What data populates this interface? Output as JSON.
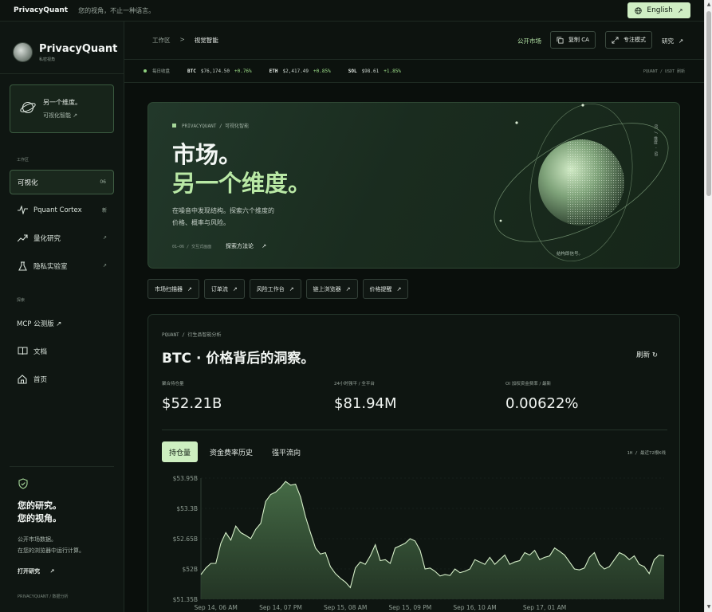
{
  "topbar": {
    "brand": "PrivacyQuant",
    "tagline": "您的视角，不止一种语言。",
    "language": "English"
  },
  "sidebar": {
    "title": "PrivacyQuant",
    "subtitle": "私密视角",
    "feature": {
      "title": "另一个维度。",
      "link": "可视化智能 ↗"
    },
    "workspace_label": "工作区",
    "items": [
      {
        "label": "可视化",
        "badge": "06",
        "icon": "layers-icon"
      },
      {
        "label": "Pquant Cortex",
        "badge": "新",
        "icon": "pulse-icon"
      },
      {
        "label": "量化研究",
        "badge": "↗",
        "icon": "trend-icon"
      },
      {
        "label": "隐私实验室",
        "badge": "↗",
        "icon": "flask-icon"
      }
    ],
    "explore_label": "探索",
    "explore_items": [
      {
        "label": "MCP 公测版 ↗"
      },
      {
        "label": "文档",
        "icon": "book-icon"
      },
      {
        "label": "首页",
        "icon": "home-icon"
      }
    ],
    "quote_l1": "您的研究。",
    "quote_l2": "您的视角。",
    "desc_l1": "公开市场数据。",
    "desc_l2": "在您的浏览器中运行计算。",
    "cta": "打开研究",
    "footer": "PRIVACYQUANT / 数据分析"
  },
  "header": {
    "crumb_root": "工作区",
    "crumb_sep": ">",
    "crumb_current": "视觉智能",
    "public_market": "公开市场",
    "copy_ca": "复制 CA",
    "focus_mode": "专注模式",
    "research": "研究"
  },
  "ticker": {
    "label": "每日收盘",
    "items": [
      {
        "sym": "BTC",
        "price": "$76,174.50",
        "chg": "+0.76%"
      },
      {
        "sym": "ETH",
        "price": "$2,417.49",
        "chg": "+0.85%"
      },
      {
        "sym": "SOL",
        "price": "$98.61",
        "chg": "+1.85%"
      }
    ],
    "right": "PQUANT / USDT 刷新"
  },
  "hero": {
    "tag": "PRIVACYQUANT / 可视化智能",
    "h1_l1": "市场。",
    "h1_l2": "另一个维度。",
    "p_l1": "在噪音中发现结构。探索六个维度的",
    "p_l2": "价格、概率与风险。",
    "meta": "01–06 / 交互式画面",
    "link": "探索方法论",
    "vertical": "01 / 维度 · 6D",
    "orb_caption": "结构即信号。"
  },
  "tools": [
    "市场扫描器",
    "订单流",
    "风险工作台",
    "链上浏览器",
    "价格提醒"
  ],
  "panel": {
    "tag": "PQUANT / 衍生品智能分析",
    "title": "BTC · 价格背后的洞察。",
    "refresh": "刷新 ↻",
    "stats": [
      {
        "label": "聚合持仓量",
        "value": "$52.21B"
      },
      {
        "label": "24小时强平 / 全平台",
        "value": "$81.94M"
      },
      {
        "label": "OI 加权资金费率 / 最新",
        "value": "0.00622%"
      }
    ],
    "tabs": [
      "持仓量",
      "资金费率历史",
      "强平流向"
    ],
    "range": "1H / 最近72根K线"
  },
  "colors": {
    "accent": "#cdeec0",
    "accent_text": "#b9e8a5",
    "positive": "#9ee08a",
    "background": "#0b100d"
  },
  "chart_data": {
    "type": "area",
    "ylim": [
      51.35,
      53.95
    ],
    "y_ticks": [
      "$53.95B",
      "$53.3B",
      "$52.65B",
      "$52B",
      "$51.35B"
    ],
    "y_tick_values": [
      53.95,
      53.3,
      52.65,
      52.0,
      51.35
    ],
    "x_ticks": [
      "Sep 14, 06 AM",
      "Sep 14, 07 PM",
      "Sep 15, 08 AM",
      "Sep 15, 09 PM",
      "Sep 16, 10 AM",
      "Sep 17, 01 AM"
    ],
    "x_tick_index": [
      3,
      16,
      29,
      42,
      55,
      69
    ],
    "series": [
      {
        "values": [
          51.88,
          52.02,
          52.12,
          52.12,
          52.55,
          52.78,
          52.62,
          52.92,
          52.78,
          52.72,
          52.65,
          52.85,
          52.98,
          53.45,
          53.6,
          53.65,
          53.75,
          53.88,
          53.8,
          53.82,
          53.55,
          53.12,
          52.78,
          52.45,
          52.32,
          52.35,
          52.05,
          51.9,
          51.8,
          51.72,
          51.6,
          52.02,
          52.15,
          52.1,
          52.28,
          52.52,
          52.18,
          52.2,
          52.12,
          52.45,
          52.5,
          52.55,
          52.65,
          52.6,
          52.4,
          52.0,
          52.02,
          51.95,
          51.85,
          51.88,
          51.86,
          52.0,
          51.92,
          51.95,
          52.0,
          52.2,
          52.15,
          52.1,
          52.25,
          52.1,
          52.2,
          52.3,
          52.1,
          52.15,
          52.18,
          52.35,
          52.3,
          52.4,
          52.2,
          52.25,
          52.28,
          52.45,
          52.38,
          52.3,
          52.15,
          52.0,
          51.98,
          52.02,
          52.25,
          52.35,
          52.1,
          52.0,
          52.05,
          52.2,
          52.35,
          52.3,
          52.2,
          52.28,
          52.1,
          52.05,
          51.9,
          52.2,
          52.3,
          52.28
        ]
      }
    ]
  }
}
